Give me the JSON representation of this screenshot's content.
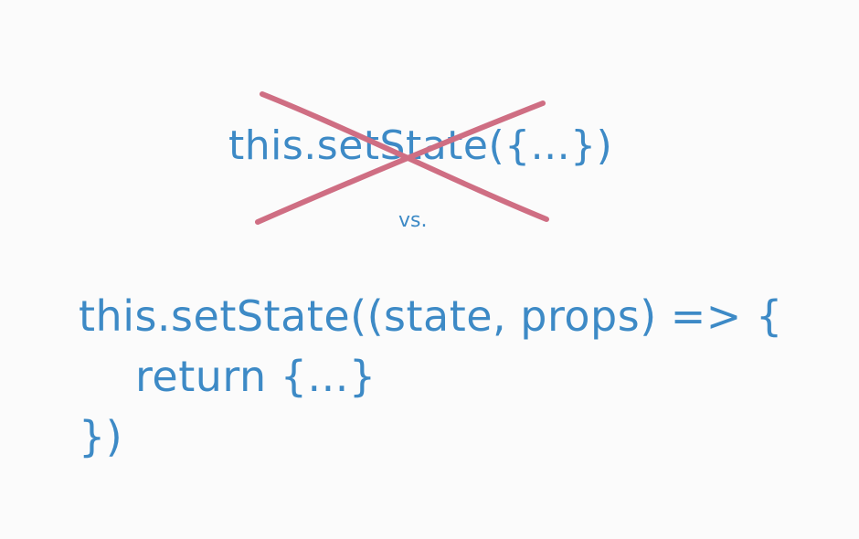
{
  "theme": {
    "text_color": "#3d8ac6",
    "strike_color": "#cf6e83",
    "background": "#fbfbfb"
  },
  "old_approach": {
    "code": "this.setState({...})",
    "crossed_out": true
  },
  "separator": "vs.",
  "new_approach": {
    "lines": [
      "this.setState((state, props) => {",
      "return {...}",
      "})"
    ]
  }
}
